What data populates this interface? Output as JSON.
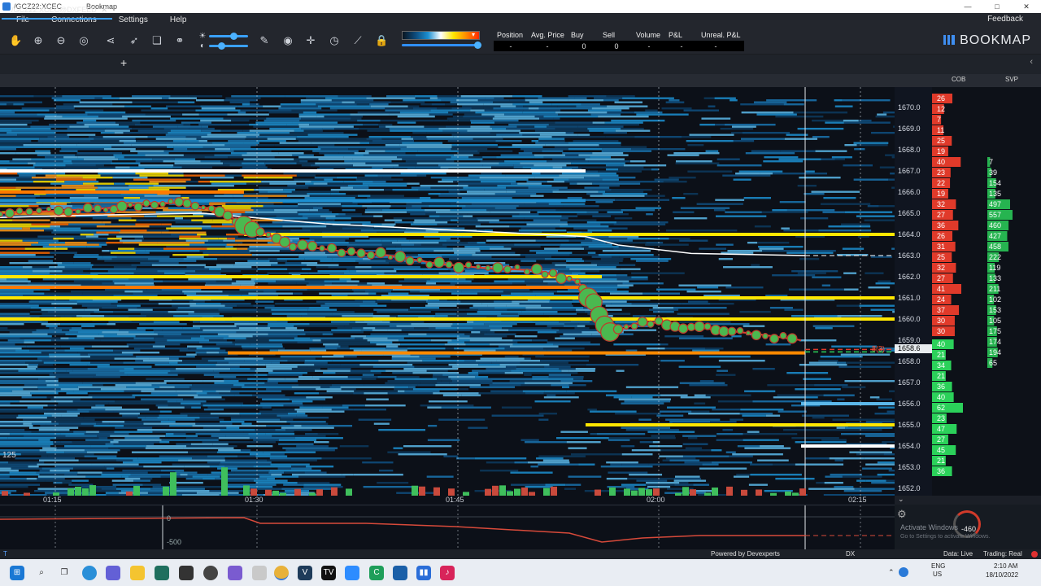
{
  "window": {
    "title": "/GCZ22:XCEC",
    "app": "Bookmap",
    "controls": [
      "—",
      "□",
      "✕"
    ]
  },
  "menu": {
    "items": [
      "File",
      "Connections",
      "Settings",
      "Help"
    ],
    "feedback": "Feedback"
  },
  "toolbar": {
    "icons": [
      "hand-icon",
      "zoom-in-icon",
      "zoom-out-icon",
      "zoom-fit-icon",
      "share-icon",
      "rocket-icon",
      "layers-icon",
      "link-icon",
      "brightness-icon",
      "contrast-icon",
      "pen-icon",
      "chat-icon",
      "crosshair-icon",
      "timer-icon",
      "chart-icon",
      "lock-icon"
    ],
    "position_headers": [
      "Position",
      "Avg. Price",
      "Buy",
      "Sell",
      "Volume",
      "P&L",
      "Unreal. P&L"
    ],
    "position_values": [
      "-",
      "-",
      "0",
      "0",
      "-",
      "-",
      "-"
    ],
    "logo": "BOOKMAP"
  },
  "tab": {
    "label": "/GCZ22:XCEC@DXFEED",
    "close": "✕",
    "add": "+"
  },
  "columns": {
    "cob": "COB",
    "svp": "SVP"
  },
  "price_axis": {
    "labels": [
      "1670.0",
      "1669.0",
      "1668.0",
      "1667.0",
      "1666.0",
      "1665.0",
      "1664.0",
      "1663.0",
      "1662.0",
      "1661.0",
      "1660.0",
      "1659.0",
      "1658.0",
      "1657.0",
      "1656.0",
      "1655.0",
      "1654.0",
      "1653.0",
      "1652.0"
    ],
    "current_price": "1658.6",
    "last_trade_marker": "8(3)"
  },
  "cob": {
    "ask_sizes": [
      "26",
      "12",
      "7",
      "11",
      "25",
      "19",
      "40",
      "23",
      "22",
      "19",
      "32",
      "27",
      "36",
      "26",
      "31",
      "25",
      "32",
      "27",
      "41",
      "24",
      "37",
      "30",
      "30"
    ],
    "bid_sizes": [
      "40",
      "21",
      "34",
      "21",
      "36",
      "40",
      "62",
      "23",
      "47",
      "27",
      "45",
      "21",
      "36"
    ]
  },
  "svp": {
    "values": [
      "7",
      "39",
      "154",
      "135",
      "497",
      "557",
      "460",
      "427",
      "458",
      "222",
      "119",
      "133",
      "211",
      "102",
      "153",
      "105",
      "175",
      "174",
      "194",
      "65"
    ]
  },
  "time_axis": {
    "labels": [
      "01:15",
      "01:30",
      "01:45",
      "02:00",
      "02:15"
    ]
  },
  "volume_label": "125",
  "lower_indicator": {
    "zero_label": "0",
    "min_label": "-500",
    "dial_value": "-460"
  },
  "watermark": {
    "line1": "Activate Windows",
    "line2": "Go to Settings to activate Windows."
  },
  "status": {
    "powered": "Powered by Devexperts",
    "dx": "DX",
    "data": "Data: Live",
    "trading": "Trading: Real"
  },
  "taskbar": {
    "apps": [
      "start",
      "search",
      "taskview",
      "edge",
      "teams",
      "files",
      "app1",
      "app2",
      "app3",
      "app4",
      "chrome",
      "venv",
      "tv",
      "zoom",
      "excel",
      "vscode",
      "bars",
      "tiktok"
    ],
    "lang1": "ENG",
    "lang2": "US",
    "time": "2:10 AM",
    "date": "18/10/2022"
  },
  "colors": {
    "bg": "#0c1018",
    "ask": "#e03a2a",
    "bid": "#2bd15a",
    "heat_low": "#0d4a7a",
    "heat_mid": "#1c8fd1",
    "heat_high": "#ffe600",
    "heat_max": "#ff7a00",
    "trade_bubble": "#4bb84f",
    "vwap": "#ffffff"
  }
}
